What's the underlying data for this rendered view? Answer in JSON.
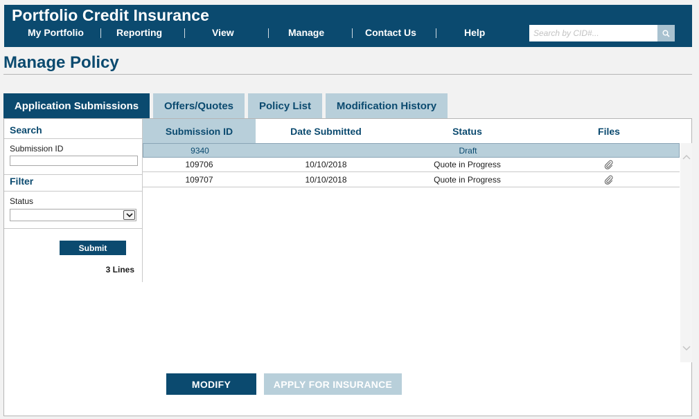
{
  "header": {
    "title": "Portfolio Credit Insurance",
    "nav": [
      {
        "label": "My Portfolio"
      },
      {
        "label": "Reporting"
      },
      {
        "label": "View"
      },
      {
        "label": "Manage"
      },
      {
        "label": "Contact Us"
      },
      {
        "label": "Help"
      }
    ],
    "search": {
      "placeholder": "Search by CID#...",
      "value": "",
      "icon": "search-icon"
    }
  },
  "page": {
    "title": "Manage Policy"
  },
  "tabs": [
    {
      "label": "Application Submissions",
      "active": true
    },
    {
      "label": "Offers/Quotes",
      "active": false
    },
    {
      "label": "Policy List",
      "active": false
    },
    {
      "label": "Modification History",
      "active": false
    }
  ],
  "sidebar": {
    "search_heading": "Search",
    "submission_id_label": "Submission ID",
    "submission_id_value": "",
    "filter_heading": "Filter",
    "status_label": "Status",
    "status_value": "",
    "submit_label": "Submit",
    "lines_count": "3 Lines"
  },
  "table": {
    "columns": [
      {
        "label": "Submission ID",
        "sorted": true
      },
      {
        "label": "Date Submitted",
        "sorted": false
      },
      {
        "label": "Status",
        "sorted": false
      },
      {
        "label": "Files",
        "sorted": false
      }
    ],
    "rows": [
      {
        "submission_id": "9340",
        "date_submitted": "",
        "status": "Draft",
        "has_file": false,
        "selected": true
      },
      {
        "submission_id": "109706",
        "date_submitted": "10/10/2018",
        "status": "Quote in Progress",
        "has_file": true,
        "selected": false
      },
      {
        "submission_id": "109707",
        "date_submitted": "10/10/2018",
        "status": "Quote in Progress",
        "has_file": true,
        "selected": false
      }
    ]
  },
  "actions": {
    "modify_label": "MODIFY",
    "apply_label": "APPLY FOR INSURANCE",
    "apply_enabled": false
  },
  "colors": {
    "brand": "#0b4a6f",
    "accent_light": "#b8cfda",
    "search_button": "#a9c2d0"
  }
}
